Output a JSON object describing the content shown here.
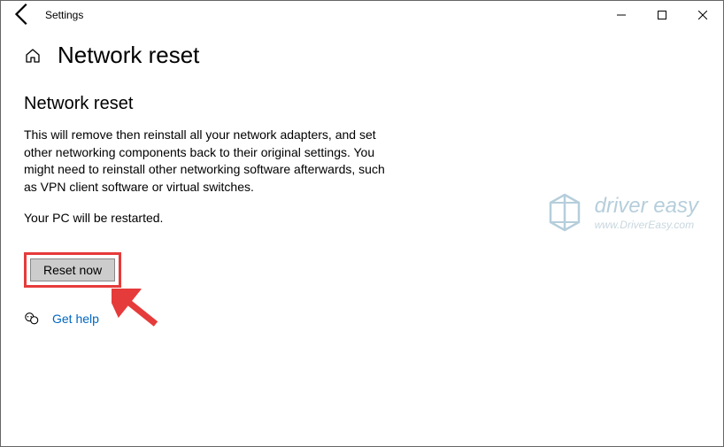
{
  "titlebar": {
    "app_name": "Settings"
  },
  "header": {
    "page_title": "Network reset"
  },
  "main": {
    "heading": "Network reset",
    "description": "This will remove then reinstall all your network adapters, and set other networking components back to their original settings. You might need to reinstall other networking software afterwards, such as VPN client software or virtual switches.",
    "restart_notice": "Your PC will be restarted.",
    "reset_button_label": "Reset now",
    "help_link_label": "Get help"
  },
  "watermark": {
    "brand": "driver easy",
    "url": "www.DriverEasy.com"
  }
}
